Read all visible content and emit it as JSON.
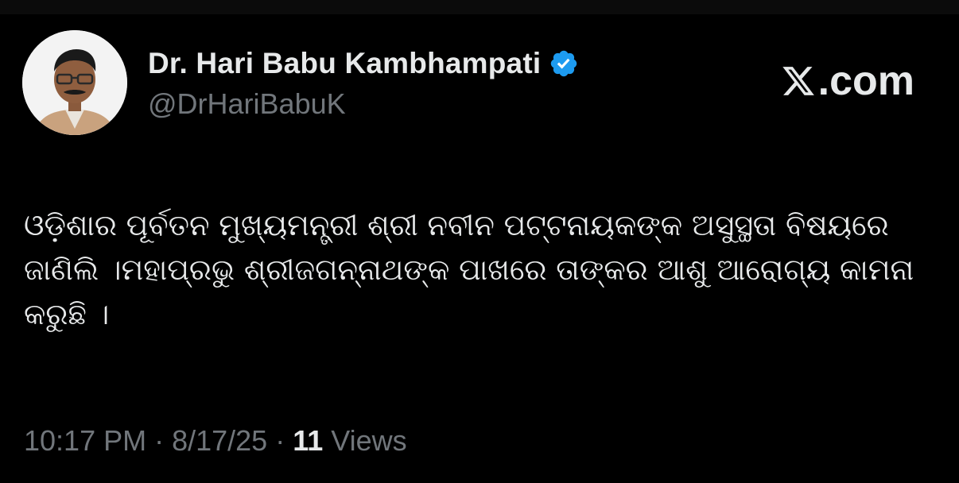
{
  "author": {
    "display_name": "Dr. Hari Babu Kambhampati",
    "handle": "@DrHariBabuK",
    "verified": true,
    "verified_badge_icon": "verified-badge-icon",
    "avatar_icon": "profile-photo"
  },
  "brand": {
    "logo_icon": "x-logo-icon",
    "text": ".com"
  },
  "post": {
    "text": "ଓଡ଼ିଶାର ପୂର୍ବତନ ମୁଖ୍ୟମନ୍ତ୍ରୀ ଶ୍ରୀ ନବୀନ ପଟ୍ଟନାୟକଙ୍କ ଅସୁସ୍ଥତା ବିଷୟରେ ଜାଣିଲି ।ମହାପ୍ରଭୁ ଶ୍ରୀଜଗନ୍ନାଥଙ୍କ ପାଖରେ ତାଙ୍କର ଆଶୁ ଆରୋଗ୍ୟ କାମନା କରୁଛି ।"
  },
  "meta": {
    "time": "10:17 PM",
    "separator": " · ",
    "date": "8/17/25",
    "views_count": "11",
    "views_label": " Views"
  },
  "colors": {
    "background": "#000000",
    "primary_text": "#e7e9ea",
    "secondary_text": "#71767b",
    "verified_blue": "#1d9bf0"
  }
}
